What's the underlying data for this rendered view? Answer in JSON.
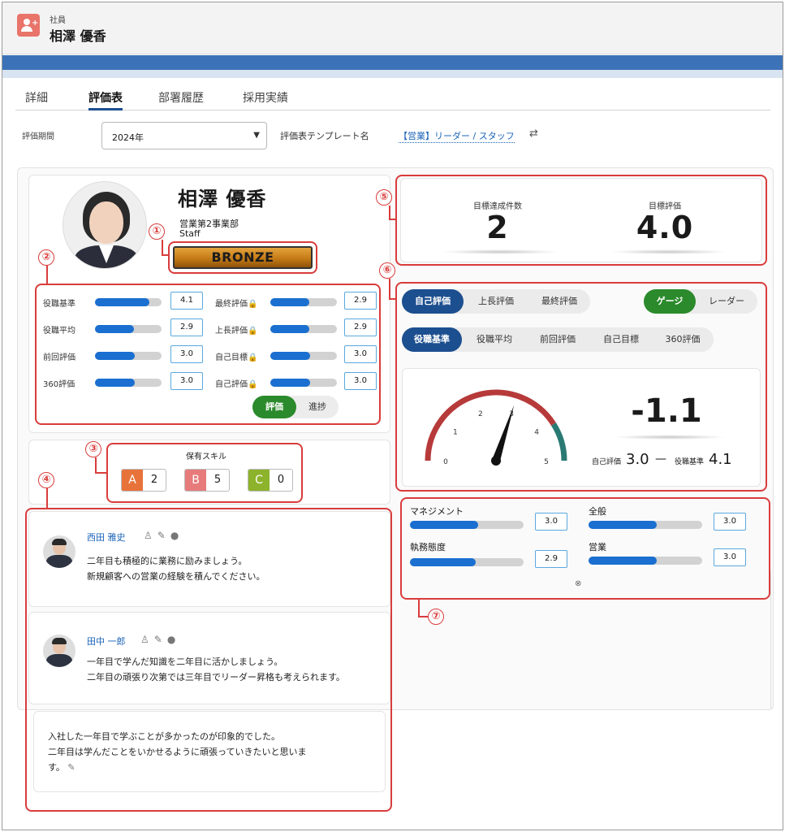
{
  "header": {
    "object_type": "社員",
    "record_name": "相澤 優香"
  },
  "tabs": [
    {
      "label": "詳細"
    },
    {
      "label": "評価表",
      "active": true
    },
    {
      "label": "部署履歴"
    },
    {
      "label": "採用実績"
    }
  ],
  "filter": {
    "period_label": "評価期間",
    "period_value": "2024年",
    "template_label": "評価表テンプレート名",
    "template_value": "【営業】リーダー / スタッフ"
  },
  "profile": {
    "name": "相澤 優香",
    "department": "営業第2事業部",
    "role": "Staff",
    "rank": "BRONZE"
  },
  "markers": [
    "①",
    "②",
    "③",
    "④",
    "⑤",
    "⑥",
    "⑦"
  ],
  "stats": {
    "left": [
      {
        "label": "役職基準",
        "value": "4.1",
        "fill": 0.82
      },
      {
        "label": "役職平均",
        "value": "2.9",
        "fill": 0.58
      },
      {
        "label": "前回評価",
        "value": "3.0",
        "fill": 0.6
      },
      {
        "label": "360評価",
        "value": "3.0",
        "fill": 0.6
      }
    ],
    "right": [
      {
        "label": "最終評価",
        "value": "2.9",
        "fill": 0.58
      },
      {
        "label": "上長評価",
        "value": "2.9",
        "fill": 0.58
      },
      {
        "label": "自己目標",
        "value": "3.0",
        "fill": 0.6
      },
      {
        "label": "自己評価",
        "value": "3.0",
        "fill": 0.6
      }
    ],
    "toggle": {
      "on": "評価",
      "off": "進捗"
    }
  },
  "skills": {
    "title": "保有スキル",
    "items": [
      {
        "grade": "A",
        "count": "2",
        "color": "#e8733a"
      },
      {
        "grade": "B",
        "count": "5",
        "color": "#e77b7b"
      },
      {
        "grade": "C",
        "count": "0",
        "color": "#8db32c"
      }
    ]
  },
  "comments": [
    {
      "author": "西田 雅史",
      "lines": [
        "二年目も積極的に業務に励みましょう。",
        "新規顧客への営業の経験を積んでください。"
      ]
    },
    {
      "author": "田中 一郎",
      "lines": [
        "一年目で学んだ知識を二年目に活かしましょう。",
        "二年目の頑張り次第では三年目でリーダー昇格も考えられます。"
      ]
    }
  ],
  "self_comment": {
    "lines": [
      "入社した一年目で学ぶことが多かったのが印象的でした。",
      "二年目は学んだことをいかせるように頑張っていきたいと思いま",
      "す。"
    ]
  },
  "kpi": [
    {
      "label": "目標達成件数",
      "value": "2"
    },
    {
      "label": "目標評価",
      "value": "4.0"
    }
  ],
  "eval_selector": {
    "sources": [
      "自己評価",
      "上長評価",
      "最終評価"
    ],
    "selected_source": "自己評価",
    "views": [
      "ゲージ",
      "レーダー"
    ],
    "selected_view": "ゲージ",
    "compare": [
      "役職基準",
      "役職平均",
      "前回評価",
      "自己目標",
      "360評価"
    ],
    "selected_compare": "役職基準"
  },
  "gauge": {
    "min": 0,
    "max": 5,
    "ticks": [
      "0",
      "1",
      "2",
      "3",
      "4",
      "5"
    ],
    "needle_value": 3.0,
    "target_value": 4.1,
    "diff": "-1.1",
    "self_label": "自己評価",
    "self_value": "3.0",
    "base_label": "役職基準",
    "base_value": "4.1",
    "dash": "—",
    "colors": {
      "low": "#b73a3a",
      "high": "#2a7a74",
      "needle": "#111111"
    }
  },
  "categories": [
    {
      "label": "マネジメント",
      "value": "3.0",
      "fill": 0.6
    },
    {
      "label": "全般",
      "value": "3.0",
      "fill": 0.6
    },
    {
      "label": "執務態度",
      "value": "2.9",
      "fill": 0.58
    },
    {
      "label": "営業",
      "value": "3.0",
      "fill": 0.6
    }
  ]
}
